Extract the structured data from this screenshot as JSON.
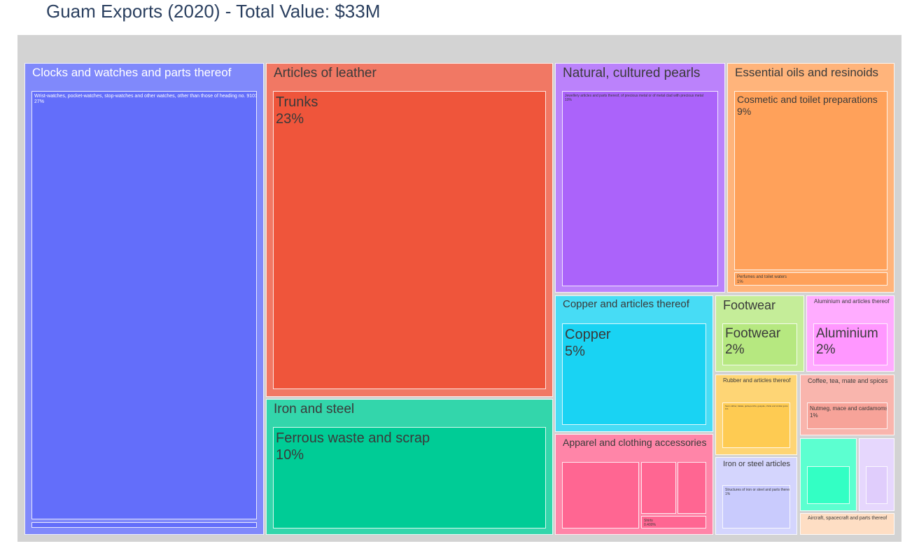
{
  "title": "Guam Exports (2020) - Total Value: $33M",
  "chart_data": {
    "type": "treemap",
    "title": "Guam Exports (2020) - Total Value: $33M",
    "groups": [
      {
        "name": "Clocks and watches and parts thereof",
        "color": "#636efa",
        "children": [
          {
            "name": "Wrist-watches, pocket-watches, stop-watches and other watches, other than those of heading no. 9101",
            "share": "27%",
            "color": "#636efa"
          },
          {
            "name": "",
            "share": "",
            "color": "#636efa"
          }
        ]
      },
      {
        "name": "Articles of leather",
        "color": "#ef553b",
        "children": [
          {
            "name": "Trunks",
            "share": "23%",
            "color": "#ef553b"
          }
        ]
      },
      {
        "name": "Iron and steel",
        "color": "#00cc96",
        "children": [
          {
            "name": "Ferrous waste and scrap",
            "share": "10%",
            "color": "#00cc96"
          }
        ]
      },
      {
        "name": "Natural, cultured pearls",
        "color": "#ab63fa",
        "children": [
          {
            "name": "Jewellery articles and parts thereof, of precious metal or of metal clad with precious metal",
            "share": "10%",
            "color": "#ab63fa"
          }
        ]
      },
      {
        "name": "Essential oils and resinoids",
        "color": "#ffa15a",
        "children": [
          {
            "name": "Cosmetic and toilet preparations",
            "share": "9%",
            "color": "#ffa15a"
          },
          {
            "name": "Perfumes and toilet waters",
            "share": "1%",
            "color": "#ffa15a"
          }
        ]
      },
      {
        "name": "Copper and articles thereof",
        "color": "#19d3f3",
        "children": [
          {
            "name": "Copper",
            "share": "5%",
            "color": "#19d3f3"
          }
        ]
      },
      {
        "name": "Apparel and clothing accessories",
        "color": "#ff6692",
        "children": [
          {
            "name": "",
            "share": "",
            "color": "#ff6692"
          },
          {
            "name": "",
            "share": "",
            "color": "#ff6692"
          },
          {
            "name": "",
            "share": "",
            "color": "#ff6692"
          },
          {
            "name": "Shirts",
            "share": "0.400%",
            "color": "#ff6692"
          }
        ]
      },
      {
        "name": "Footwear",
        "color": "#b6e880",
        "children": [
          {
            "name": "Footwear",
            "share": "2%",
            "color": "#b6e880"
          }
        ]
      },
      {
        "name": "Aluminium and articles thereof",
        "color": "#ff97ff",
        "children": [
          {
            "name": "Aluminium",
            "share": "2%",
            "color": "#ff97ff"
          }
        ]
      },
      {
        "name": "Rubber and articles thereof",
        "color": "#fecb52",
        "children": [
          {
            "name": "Semi-rubber, balata, gutta-percha, guayule, chicle and similar gums",
            "share": "1%",
            "color": "#fecb52"
          }
        ]
      },
      {
        "name": "Coffee, tea, mate and spices",
        "color": "#f7a399",
        "children": [
          {
            "name": "Nutmeg, mace and cardamoms",
            "share": "1%",
            "color": "#f7a399"
          }
        ]
      },
      {
        "name": "Iron or steel articles",
        "color": "#c9cbfd",
        "children": [
          {
            "name": "Structures of iron or steel and parts thereof",
            "share": "1%",
            "color": "#c9cbfd"
          }
        ]
      },
      {
        "name": "",
        "color": "#33ffc4",
        "children": [
          {
            "name": "",
            "share": "",
            "color": "#33ffc4"
          }
        ]
      },
      {
        "name": "",
        "color": "#e0cdfc",
        "children": [
          {
            "name": "",
            "share": "",
            "color": "#e0cdfc"
          }
        ]
      },
      {
        "name": "Aircraft, spacecraft and parts thereof",
        "color": "#fedec4",
        "children": []
      }
    ]
  }
}
